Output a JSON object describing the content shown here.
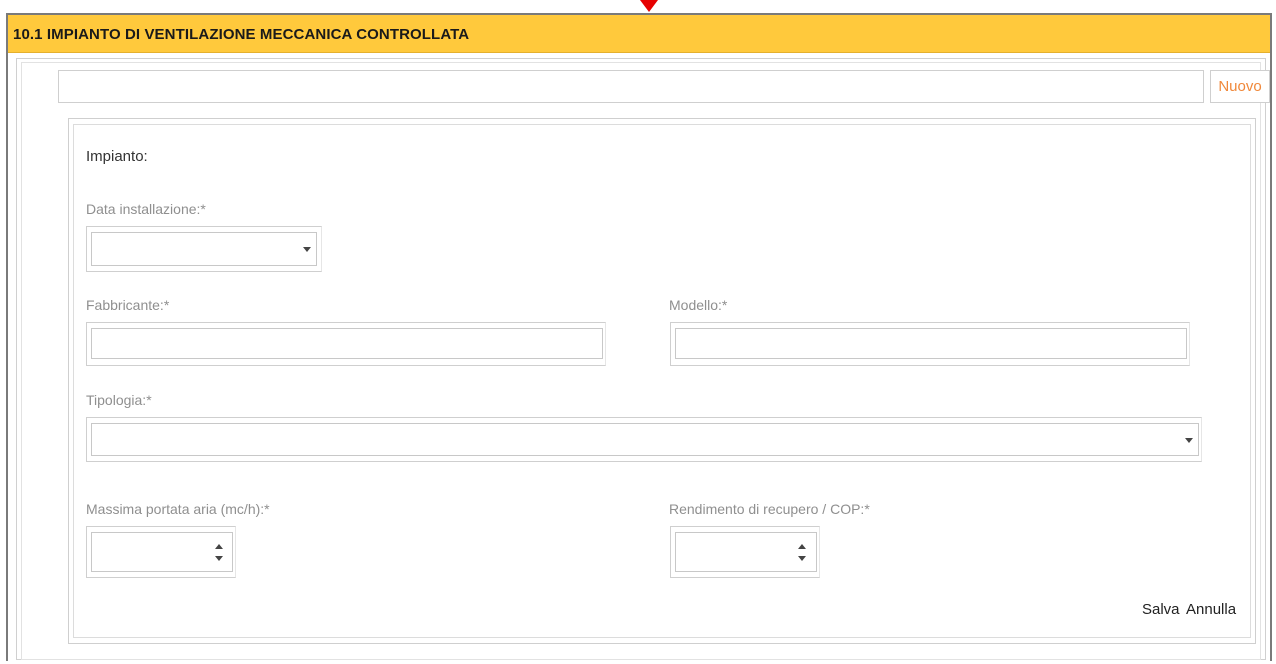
{
  "header": {
    "title": "10.1 IMPIANTO DI VENTILAZIONE MECCANICA CONTROLLATA"
  },
  "toolbar": {
    "new_label": "Nuovo",
    "selector_value": ""
  },
  "form": {
    "section_title": "Impianto:",
    "data_installazione": {
      "label": "Data installazione:",
      "required": "*",
      "value": ""
    },
    "fabbricante": {
      "label": "Fabbricante:",
      "required": "*",
      "value": ""
    },
    "modello": {
      "label": "Modello:",
      "required": "*",
      "value": ""
    },
    "tipologia": {
      "label": "Tipologia:",
      "required": "*",
      "value": ""
    },
    "massima_portata": {
      "label": "Massima portata aria (mc/h):",
      "required": "*",
      "value": ""
    },
    "rendimento": {
      "label": "Rendimento di recupero / COP:",
      "required": "*",
      "value": ""
    },
    "actions": {
      "save_label": "Salva",
      "cancel_label": "Annulla"
    }
  },
  "colors": {
    "header_bg": "#ffc93c",
    "accent": "#f0883a",
    "marker": "#e60000"
  }
}
